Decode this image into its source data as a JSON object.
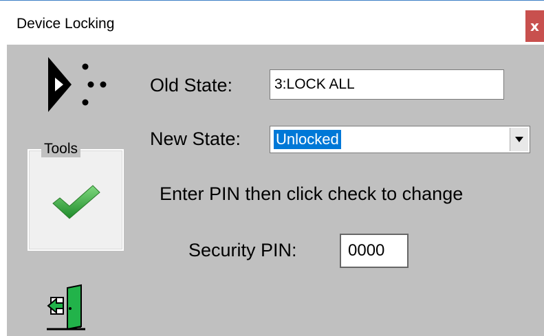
{
  "window": {
    "title": "Device Locking",
    "close_label": "x",
    "close_color": "#c8504e",
    "client_background": "#c0c0c0"
  },
  "form": {
    "old_state_label": "Old State:",
    "old_state_value": "3:LOCK ALL",
    "new_state_label": "New State:",
    "new_state_value": "Unlocked",
    "instruction": "Enter PIN then click check to change",
    "pin_label": "Security PIN:",
    "pin_value": "0000"
  },
  "tools": {
    "legend": "Tools",
    "check_icon": "green-check-icon"
  },
  "icons": {
    "logo": "device-lock-logo",
    "exit": "exit-door-icon",
    "dropdown": "dropdown-arrow-icon"
  },
  "colors": {
    "selection": "#0078d7",
    "check_green": "#3aa83a",
    "door_green": "#22b34a"
  }
}
